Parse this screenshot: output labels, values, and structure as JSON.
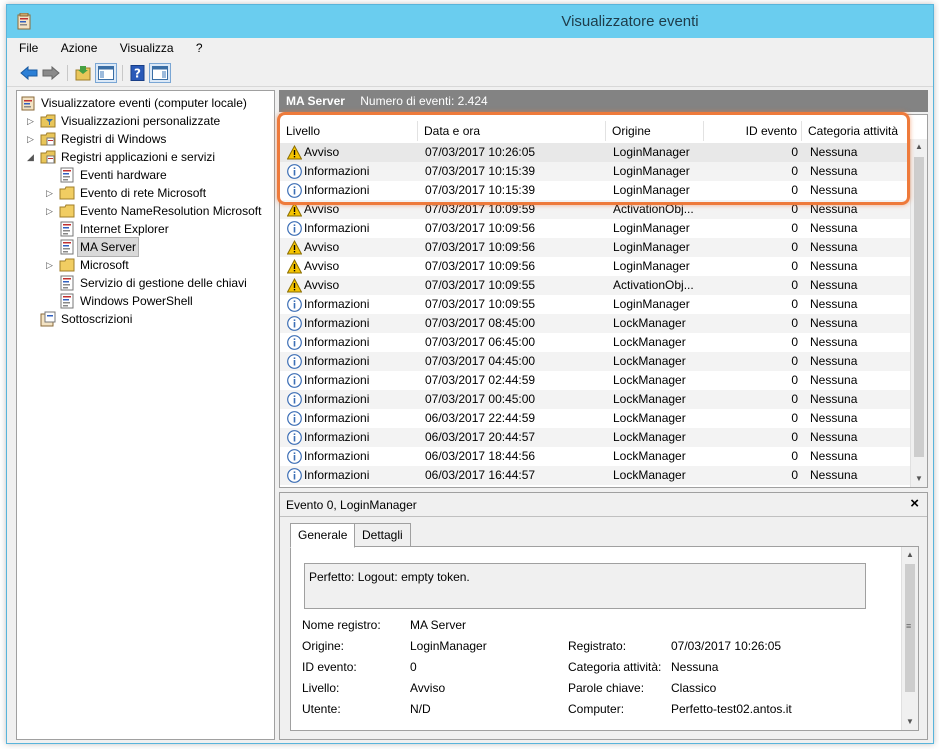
{
  "window": {
    "title": "Visualizzatore eventi"
  },
  "menu": [
    "File",
    "Azione",
    "Visualizza",
    "?"
  ],
  "toolbar": {
    "buttons": [
      "back-icon",
      "forward-icon",
      "open-log-icon",
      "show-hide-pane-icon",
      "help-icon",
      "show-hide-action-pane-icon"
    ]
  },
  "tree": {
    "items": [
      {
        "label": "Visualizzatore eventi (computer locale)",
        "icon": "event-viewer-icon",
        "level": 0,
        "arrow": ""
      },
      {
        "label": "Visualizzazioni personalizzate",
        "icon": "folder-filter-icon",
        "level": 1,
        "arrow": "collapsed"
      },
      {
        "label": "Registri di Windows",
        "icon": "folder-log-icon",
        "level": 1,
        "arrow": "collapsed"
      },
      {
        "label": "Registri applicazioni e servizi",
        "icon": "folder-log-icon",
        "level": 1,
        "arrow": "expanded"
      },
      {
        "label": "Eventi hardware",
        "icon": "log-icon",
        "level": 2,
        "arrow": ""
      },
      {
        "label": "Evento di rete Microsoft",
        "icon": "folder-icon",
        "level": 2,
        "arrow": "collapsed"
      },
      {
        "label": "Evento NameResolution Microsoft",
        "icon": "folder-icon",
        "level": 2,
        "arrow": "collapsed"
      },
      {
        "label": "Internet Explorer",
        "icon": "log-icon",
        "level": 2,
        "arrow": ""
      },
      {
        "label": "MA Server",
        "icon": "log-icon",
        "level": 2,
        "arrow": "",
        "selected": true
      },
      {
        "label": "Microsoft",
        "icon": "folder-icon",
        "level": 2,
        "arrow": "collapsed"
      },
      {
        "label": "Servizio di gestione delle chiavi",
        "icon": "log-icon",
        "level": 2,
        "arrow": ""
      },
      {
        "label": "Windows PowerShell",
        "icon": "log-icon",
        "level": 2,
        "arrow": ""
      },
      {
        "label": "Sottoscrizioni",
        "icon": "subscription-icon",
        "level": 1,
        "arrow": ""
      }
    ]
  },
  "header_strip": {
    "title": "MA Server",
    "count": "Numero di eventi: 2.424"
  },
  "events": {
    "columns": [
      "Livello",
      "Data e ora",
      "Origine",
      "ID evento",
      "Categoria attività"
    ],
    "rows": [
      {
        "level": "Avviso",
        "type": "warning",
        "date": "07/03/2017 10:26:05",
        "source": "LoginManager",
        "id": "0",
        "category": "Nessuna"
      },
      {
        "level": "Informazioni",
        "type": "info",
        "date": "07/03/2017 10:15:39",
        "source": "LoginManager",
        "id": "0",
        "category": "Nessuna"
      },
      {
        "level": "Informazioni",
        "type": "info",
        "date": "07/03/2017 10:15:39",
        "source": "LoginManager",
        "id": "0",
        "category": "Nessuna"
      },
      {
        "level": "Avviso",
        "type": "warning",
        "date": "07/03/2017 10:09:59",
        "source": "ActivationObj...",
        "id": "0",
        "category": "Nessuna"
      },
      {
        "level": "Informazioni",
        "type": "info",
        "date": "07/03/2017 10:09:56",
        "source": "LoginManager",
        "id": "0",
        "category": "Nessuna"
      },
      {
        "level": "Avviso",
        "type": "warning",
        "date": "07/03/2017 10:09:56",
        "source": "LoginManager",
        "id": "0",
        "category": "Nessuna"
      },
      {
        "level": "Avviso",
        "type": "warning",
        "date": "07/03/2017 10:09:56",
        "source": "LoginManager",
        "id": "0",
        "category": "Nessuna"
      },
      {
        "level": "Avviso",
        "type": "warning",
        "date": "07/03/2017 10:09:55",
        "source": "ActivationObj...",
        "id": "0",
        "category": "Nessuna"
      },
      {
        "level": "Informazioni",
        "type": "info",
        "date": "07/03/2017 10:09:55",
        "source": "LoginManager",
        "id": "0",
        "category": "Nessuna"
      },
      {
        "level": "Informazioni",
        "type": "info",
        "date": "07/03/2017 08:45:00",
        "source": "LockManager",
        "id": "0",
        "category": "Nessuna"
      },
      {
        "level": "Informazioni",
        "type": "info",
        "date": "07/03/2017 06:45:00",
        "source": "LockManager",
        "id": "0",
        "category": "Nessuna"
      },
      {
        "level": "Informazioni",
        "type": "info",
        "date": "07/03/2017 04:45:00",
        "source": "LockManager",
        "id": "0",
        "category": "Nessuna"
      },
      {
        "level": "Informazioni",
        "type": "info",
        "date": "07/03/2017 02:44:59",
        "source": "LockManager",
        "id": "0",
        "category": "Nessuna"
      },
      {
        "level": "Informazioni",
        "type": "info",
        "date": "07/03/2017 00:45:00",
        "source": "LockManager",
        "id": "0",
        "category": "Nessuna"
      },
      {
        "level": "Informazioni",
        "type": "info",
        "date": "06/03/2017 22:44:59",
        "source": "LockManager",
        "id": "0",
        "category": "Nessuna"
      },
      {
        "level": "Informazioni",
        "type": "info",
        "date": "06/03/2017 20:44:57",
        "source": "LockManager",
        "id": "0",
        "category": "Nessuna"
      },
      {
        "level": "Informazioni",
        "type": "info",
        "date": "06/03/2017 18:44:56",
        "source": "LockManager",
        "id": "0",
        "category": "Nessuna"
      },
      {
        "level": "Informazioni",
        "type": "info",
        "date": "06/03/2017 16:44:57",
        "source": "LockManager",
        "id": "0",
        "category": "Nessuna"
      }
    ]
  },
  "detail": {
    "title": "Evento 0, LoginManager",
    "close": "×",
    "tabs": [
      "Generale",
      "Dettagli"
    ],
    "description": "Perfetto: Logout: empty token.",
    "fields_left": [
      {
        "label": "Nome registro:",
        "value": "MA Server"
      },
      {
        "label": "Origine:",
        "value": "LoginManager"
      },
      {
        "label": "ID evento:",
        "value": "0"
      },
      {
        "label": "Livello:",
        "value": "Avviso"
      },
      {
        "label": "Utente:",
        "value": "N/D"
      }
    ],
    "fields_right": [
      {
        "label": "Registrato:",
        "value": "07/03/2017 10:26:05"
      },
      {
        "label": "Categoria attività:",
        "value": "Nessuna"
      },
      {
        "label": "Parole chiave:",
        "value": "Classico"
      },
      {
        "label": "Computer:",
        "value": "Perfetto-test02.antos.it"
      }
    ]
  },
  "colors": {
    "titlebar": "#6acdef",
    "header_strip": "#838383",
    "callout": "#ee7a3b",
    "warning": "#f5c400",
    "info": "#3d6fb6"
  }
}
